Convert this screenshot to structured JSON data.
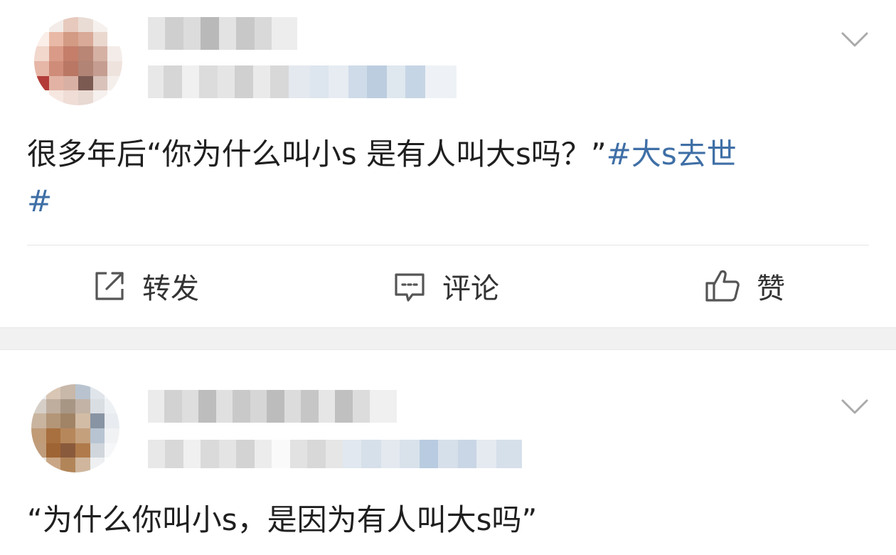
{
  "posts": [
    {
      "text_plain": "很多年后“你为什么叫小s 是有人叫大s吗？”",
      "topic": "#大s去世",
      "topic_line2": "#",
      "actions": {
        "repost_label": "转发",
        "comment_label": "评论",
        "like_label": "赞"
      }
    },
    {
      "text_plain": "“为什么你叫小s，是因为有人叫大s吗”"
    }
  ],
  "colors": {
    "topic_link": "#3f6fa6",
    "section_gap": "#f1f1f1",
    "icon_stroke": "#555555"
  },
  "icons": {
    "more": "chevron-down-icon",
    "repost": "repost-icon",
    "comment": "comment-icon",
    "like": "thumbs-up-icon"
  }
}
